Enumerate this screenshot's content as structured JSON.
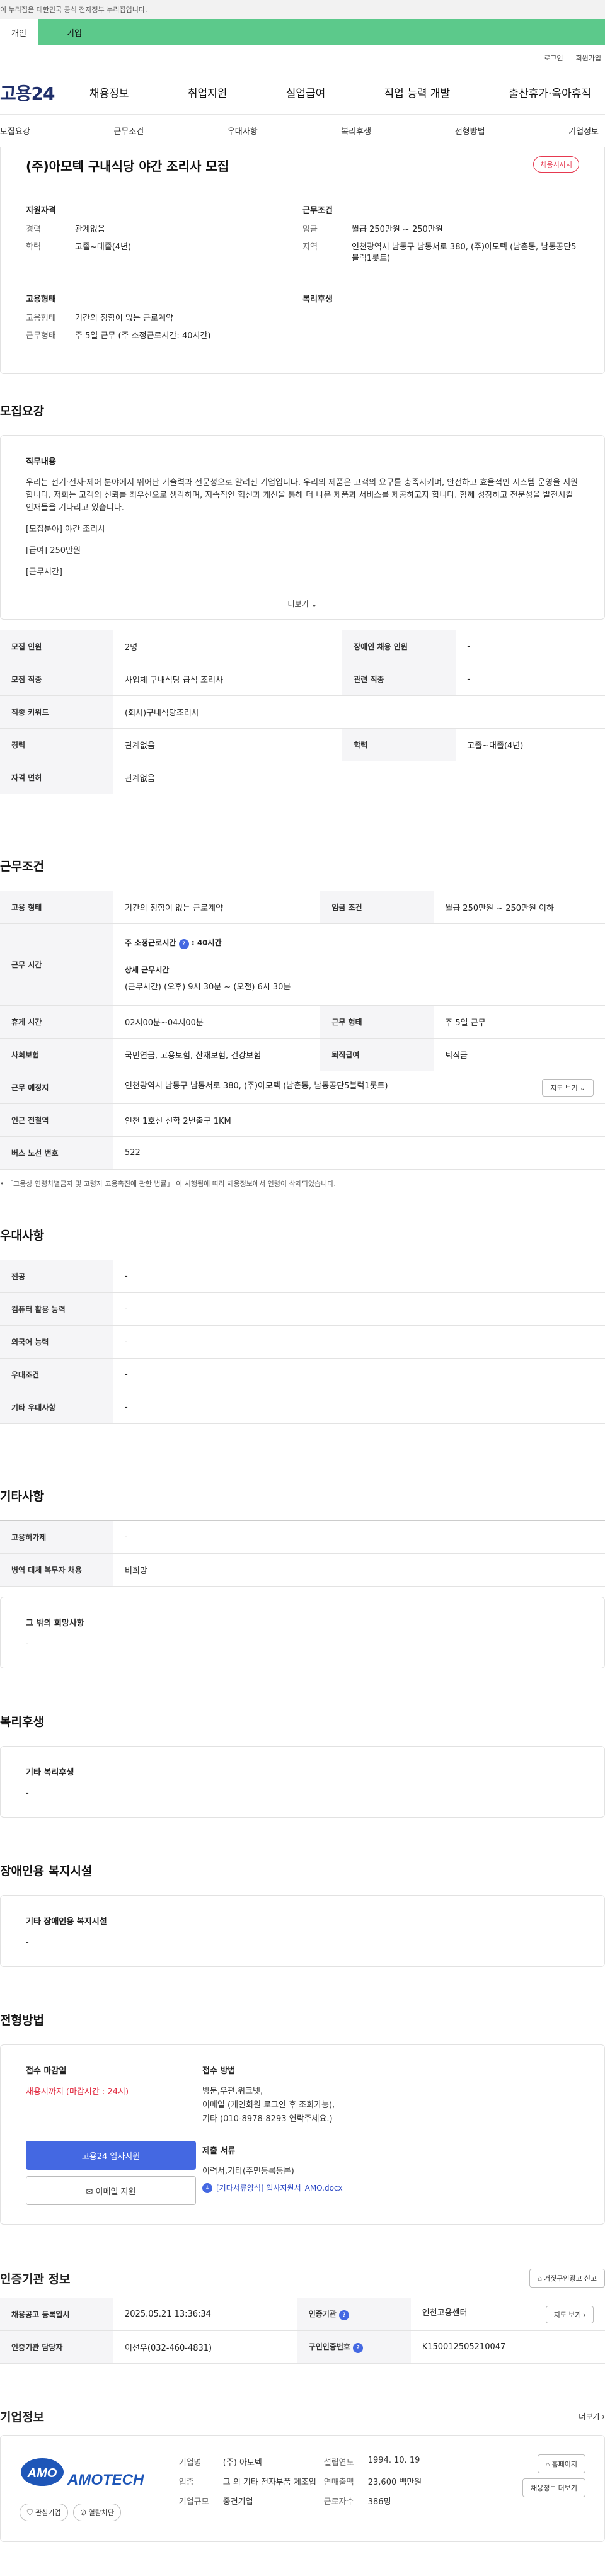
{
  "gov_bar": "이 누리집은 대한민국 공식 전자정부 누리집입니다.",
  "tabs": [
    "개인",
    "기업"
  ],
  "util": [
    "로그인",
    "회원가입"
  ],
  "logo": "고용24",
  "gnb": [
    "채용정보",
    "취업지원",
    "실업급여",
    "직업 능력 개발",
    "출산휴가·육아휴직"
  ],
  "anchors": [
    "모집요강",
    "근무조건",
    "우대사항",
    "복리후생",
    "전형방법",
    "기업정보"
  ],
  "title": "(주)아모텍 구내식당 야간 조리사 모집",
  "badge": "채용시까지",
  "summary": {
    "qual": {
      "heading": "지원자격",
      "rows": [
        [
          "경력",
          "관계없음"
        ],
        [
          "학력",
          "고졸~대졸(4년)"
        ]
      ]
    },
    "cond": {
      "heading": "근무조건",
      "rows": [
        [
          "임금",
          "월급 250만원 ~ 250만원"
        ],
        [
          "지역",
          "인천광역시 남동구 남동서로 380, (주)아모텍 (남촌동, 남동공단5블럭1롯트)"
        ]
      ]
    },
    "emp": {
      "heading": "고용형태",
      "rows": [
        [
          "고용형태",
          "기간의 정함이 없는 근로계약"
        ],
        [
          "근무형태",
          "주 5일 근무 (주 소정근로시간: 40시간)"
        ]
      ]
    },
    "welfare": {
      "heading": "복리후생",
      "rows": []
    }
  },
  "recruit": {
    "heading": "모집요강",
    "desc_heading": "직무내용",
    "desc": [
      "우리는 전기·전자·제어 분야에서 뛰어난 기술력과 전문성으로 알려진 기업입니다. 우리의 제품은 고객의 요구를 충족시키며, 안전하고 효율적인 시스템 운영을 지원합니다. 저희는 고객의 신뢰를 최우선으로 생각하며, 지속적인 혁신과 개선을 통해 더 나은 제품과 서비스를 제공하고자 합니다. 함께 성장하고 전문성을 발전시킬 인재들을 기다리고 있습니다.",
      "[모집분야] 야간 조리사",
      "[급여] 250만원",
      "[근무시간]"
    ],
    "more": "더보기",
    "table": [
      [
        "모집 인원",
        "2명",
        "장애인 채용 인원",
        "-"
      ],
      [
        "모집 직종",
        "사업체 구내식당 급식 조리사",
        "관련 직종",
        "-"
      ],
      [
        "직종 키워드",
        "(회사)구내식당조리사"
      ],
      [
        "경력",
        "관계없음",
        "학력",
        "고졸~대졸(4년)"
      ],
      [
        "자격 면허",
        "관계없음"
      ]
    ]
  },
  "work": {
    "heading": "근무조건",
    "emp_type_k": "고용 형태",
    "emp_type_v": "기간의 정함이 없는 근로계약",
    "wage_k": "임금 조건",
    "wage_v": "월급 250만원 ~ 250만원 이하",
    "hours_k": "근무 시간",
    "hours_week": "주 소정근로시간",
    "hours_week_v": "40시간",
    "hours_detail_h": "상세 근무시간",
    "hours_detail_v": "(근무시간) (오후) 9시 30분 ~ (오전) 6시 30분",
    "break_k": "휴게 시간",
    "break_v": "02시00분~04시00분",
    "form_k": "근무 형태",
    "form_v": "주 5일 근무",
    "ins_k": "사회보험",
    "ins_v": "국민연금, 고용보험, 산재보험, 건강보험",
    "sev_k": "퇴직급여",
    "sev_v": "퇴직금",
    "place_k": "근무 예정지",
    "place_v": "인천광역시 남동구 남동서로 380, (주)아모텍 (남촌동, 남동공단5블럭1롯트)",
    "map_btn": "지도 보기",
    "station_k": "인근 전철역",
    "station_v": "인천 1호선 선학 2번출구 1KM",
    "bus_k": "버스 노선 번호",
    "bus_v": "522",
    "note": "「고용상 연령차별금지 및 고령자 고용촉진에 관한 법률」 이 시행됨에 따라 채용정보에서 연령이 삭제되었습니다."
  },
  "pref": {
    "heading": "우대사항",
    "rows": [
      [
        "전공",
        "-"
      ],
      [
        "컴퓨터 활용 능력",
        "-"
      ],
      [
        "외국어 능력",
        "-"
      ],
      [
        "우대조건",
        "-"
      ],
      [
        "기타 우대사항",
        "-"
      ]
    ]
  },
  "etc": {
    "heading": "기타사항",
    "rows": [
      [
        "고용허가제",
        "-"
      ],
      [
        "병역 대체 복무자 채용",
        "비희망"
      ]
    ],
    "other_h": "그 밖의 희망사항",
    "other_v": "-"
  },
  "welfare": {
    "heading": "복리후생",
    "sub": "기타 복리후생",
    "v": "-"
  },
  "disabled": {
    "heading": "장애인용 복지시설",
    "sub": "기타 장애인용 복지시설",
    "v": "-"
  },
  "apply": {
    "heading": "전형방법",
    "deadline_h": "접수 마감일",
    "deadline_v": "채용시까지 (마감시간 : 24시)",
    "btn_primary": "고용24 입사지원",
    "btn_email": "이메일 지원",
    "method_h": "접수 방법",
    "method": [
      "방문,우편,워크넷,",
      "이메일 (개인회원 로그인 후 조회가능),",
      "기타 (010-8978-8293 연락주세요.)"
    ],
    "docs_h": "제출 서류",
    "docs": "이력서,기타(주민등록등본)",
    "file": "[기타서류양식] 입사지원서_AMO.docx"
  },
  "cert": {
    "heading": "인증기관 정보",
    "report": "거짓구인광고 신고",
    "date_k": "채용공고 등록일시",
    "date_v": "2025.05.21 13:36:34",
    "org_k": "인증기관",
    "org_v": "인천고용센터",
    "map_btn": "지도 보기",
    "mgr_k": "인증기관 담당자",
    "mgr_v": "이선우(032-460-4831)",
    "no_k": "구인인증번호",
    "no_v": "K150012505210047"
  },
  "company": {
    "heading": "기업정보",
    "more": "더보기",
    "logo_text": "AMOTECH",
    "logo_mark": "AMO",
    "fav": "관심기업",
    "block": "열람차단",
    "name_k": "기업명",
    "name_v": "(주) 아모텍",
    "ind_k": "업종",
    "ind_v": "그 외 기타 전자부품 제조업",
    "size_k": "기업규모",
    "size_v": "중견기업",
    "est_k": "설립연도",
    "est_v": "1994. 10. 19",
    "sales_k": "연매출액",
    "sales_v": "23,600 백만원",
    "emp_k": "근로자수",
    "emp_v": "386명",
    "home": "홈페이지",
    "list": "채용정보 더보기"
  }
}
